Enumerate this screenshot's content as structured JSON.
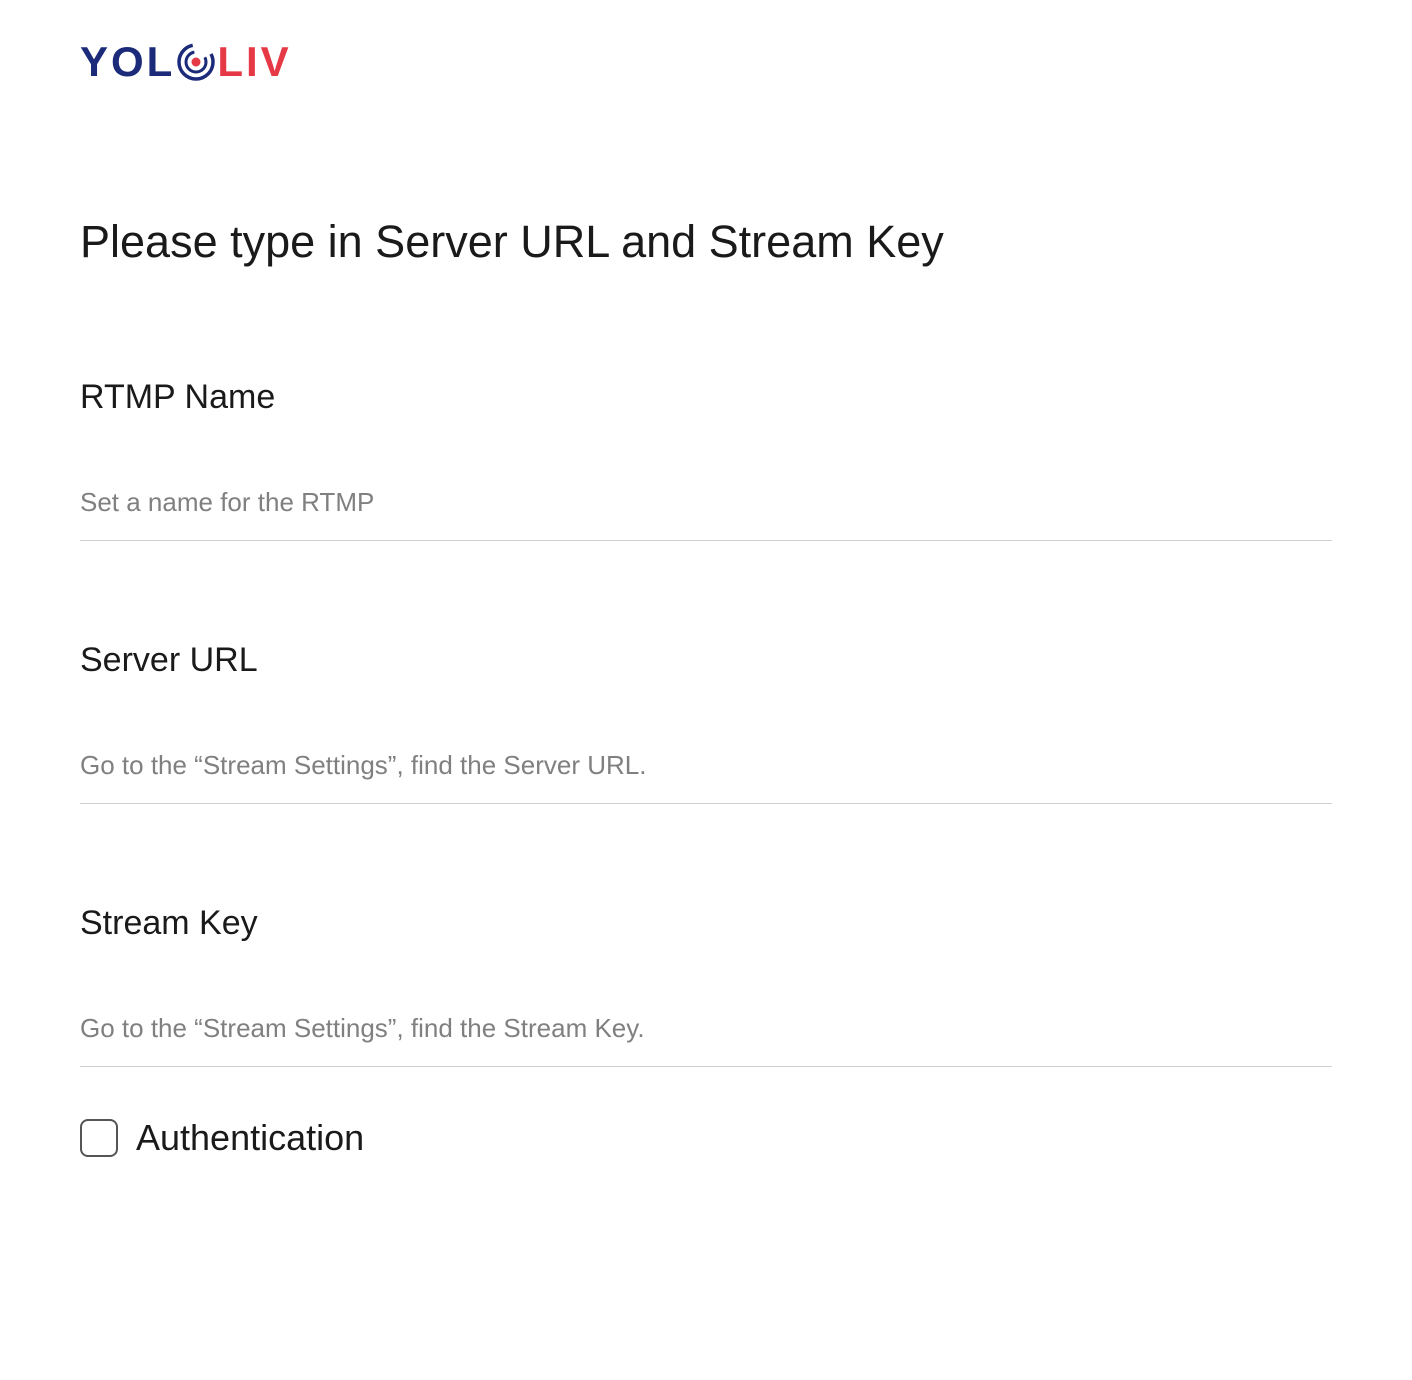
{
  "logo": {
    "part1": "YOL",
    "part2": "LIV"
  },
  "page_title": "Please type in Server URL and Stream Key",
  "form": {
    "rtmp_name": {
      "label": "RTMP Name",
      "placeholder": "Set a name for the RTMP",
      "value": ""
    },
    "server_url": {
      "label": "Server URL",
      "placeholder": "Go to the “Stream Settings”, find the Server URL.",
      "value": ""
    },
    "stream_key": {
      "label": "Stream Key",
      "placeholder": "Go to the “Stream Settings”, find the Stream Key.",
      "value": ""
    },
    "authentication": {
      "label": "Authentication",
      "checked": false
    }
  }
}
